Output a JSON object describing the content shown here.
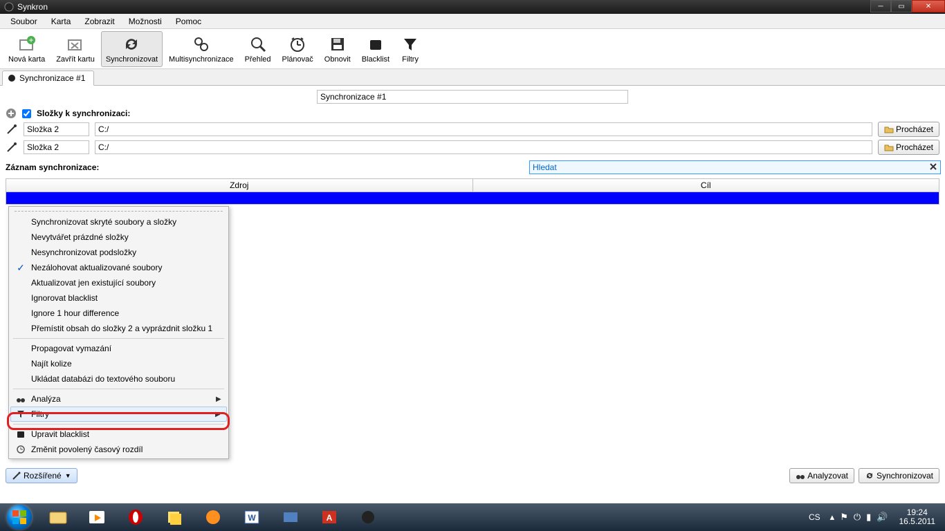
{
  "window": {
    "title": "Synkron"
  },
  "menu": {
    "file": "Soubor",
    "card": "Karta",
    "view": "Zobrazit",
    "options": "Možnosti",
    "help": "Pomoc"
  },
  "toolbar": {
    "new_card": "Nová karta",
    "close_card": "Zavřít kartu",
    "sync": "Synchronizovat",
    "multisync": "Multisynchronizace",
    "overview": "Přehled",
    "scheduler": "Plánovač",
    "refresh": "Obnovit",
    "blacklist": "Blacklist",
    "filters": "Filtry"
  },
  "tabs": [
    {
      "label": "Synchronizace #1"
    }
  ],
  "header": {
    "title_value": "Synchronizace #1",
    "folders_label": "Složky k synchronizaci:"
  },
  "folders": [
    {
      "name": "Složka 2",
      "path": "C:/",
      "browse": "Procházet"
    },
    {
      "name": "Složka 2",
      "path": "C:/",
      "browse": "Procházet"
    }
  ],
  "log": {
    "label": "Záznam synchronizace:",
    "search_value": "Hledat"
  },
  "table": {
    "col_source": "Zdroj",
    "col_target": "Cíl"
  },
  "context_menu": {
    "sync_hidden": "Synchronizovat skryté soubory a složky",
    "no_empty": "Nevytvářet prázdné složky",
    "no_subfolders": "Nesynchronizovat podsložky",
    "no_backup": "Nezálohovat aktualizované soubory",
    "only_existing": "Aktualizovat jen existující soubory",
    "ignore_blacklist": "Ignorovat blacklist",
    "ignore_1h": "Ignore 1 hour difference",
    "move_contents": "Přemístit obsah do složky 2 a vyprázdnit složku 1",
    "propagate_del": "Propagovat vymazání",
    "find_collisions": "Najít kolize",
    "save_db": "Ukládat databázi do textového souboru",
    "analysis": "Analýza",
    "filters": "Filtry",
    "edit_blacklist": "Upravit blacklist",
    "change_time": "Změnit povolený časový rozdíl"
  },
  "bottom": {
    "advanced": "Rozšířené",
    "analyze": "Analyzovat",
    "synchronize": "Synchronizovat"
  },
  "tray": {
    "lang": "CS",
    "time": "19:24",
    "date": "16.5.2011"
  }
}
